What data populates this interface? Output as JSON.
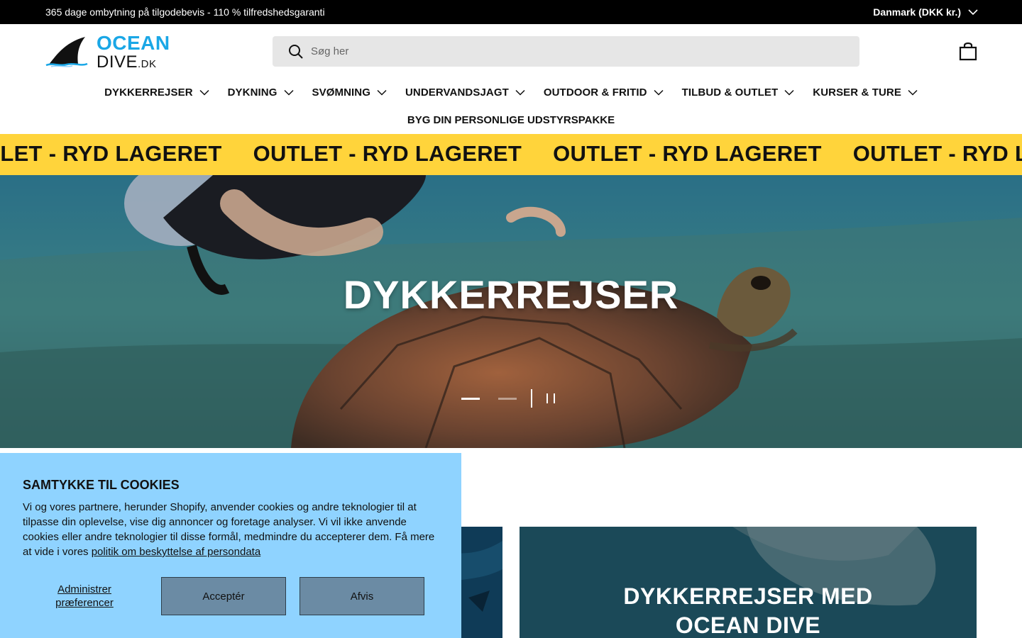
{
  "announcement": {
    "message": "365 dage ombytning på tilgodebevis - 110 % tilfredshedsgaranti",
    "country": "Danmark (DKK kr.)"
  },
  "logo": {
    "word1": "OCEAN",
    "word2": "DIVE",
    "word2_suffix": ".DK"
  },
  "search": {
    "placeholder": "Søg her"
  },
  "nav": {
    "items": [
      {
        "label": "DYKKERREJSER"
      },
      {
        "label": "DYKNING"
      },
      {
        "label": "SVØMNING"
      },
      {
        "label": "UNDERVANDSJAGT"
      },
      {
        "label": "OUTDOOR & FRITID"
      },
      {
        "label": "TILBUD & OUTLET"
      },
      {
        "label": "KURSER & TURE"
      }
    ],
    "secondary": "BYG DIN PERSONLIGE UDSTYRSPAKKE"
  },
  "marquee": {
    "text": "OUTLET - RYD LAGERET"
  },
  "hero": {
    "title": "DYKKERREJSER",
    "slide_count": 2,
    "active_slide": 1
  },
  "cards": {
    "right_title_line1": "DYKKERREJSER MED",
    "right_title_line2": "OCEAN DIVE"
  },
  "cookie": {
    "title": "SAMTYKKE TIL COOKIES",
    "body": "Vi og vores partnere, herunder Shopify, anvender cookies og andre teknologier til at tilpasse din oplevelse, vise dig annoncer og foretage analyser. Vi vil ikke anvende cookies eller andre teknologier til disse formål, medmindre du accepterer dem. Få mere at vide i vores ",
    "link": "politik om beskyttelse af persondata",
    "manage_label": "Administrer præferencer",
    "accept_label": "Acceptér",
    "reject_label": "Afvis"
  },
  "colors": {
    "brand_blue": "#1aa7e6",
    "marquee_yellow": "#ffd43b",
    "cookie_bg": "#8fd3ff",
    "cookie_button": "#6b8ba4"
  }
}
